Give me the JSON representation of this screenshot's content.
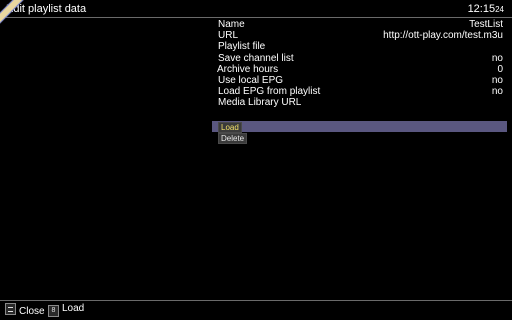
{
  "header": {
    "title": "Edit playlist data",
    "time_main": "12:15",
    "time_seconds": "24"
  },
  "settings": [
    {
      "label": "Name",
      "value": "TestList"
    },
    {
      "label": "URL",
      "value": "http://ott-play.com/test.m3u"
    },
    {
      "label": "Playlist file",
      "value": ""
    },
    {
      "label": "Save channel list",
      "value": "no"
    },
    {
      "label": "Archive hours",
      "value": "0"
    },
    {
      "label": "Use local EPG",
      "value": "no"
    },
    {
      "label": "Load EPG from playlist",
      "value": "no"
    },
    {
      "label": "Media Library URL",
      "value": ""
    }
  ],
  "actions": {
    "load_label": "Load",
    "delete_label": "Delete"
  },
  "footer": {
    "close_key_icon": "exit-key-icon",
    "close_label": "Close",
    "load_key": "8",
    "load_label": "Load"
  },
  "colors": {
    "background": "#000000",
    "selection_bar": "#5a5780",
    "load_text": "#f3e26a",
    "divider": "#6a6a6a"
  }
}
